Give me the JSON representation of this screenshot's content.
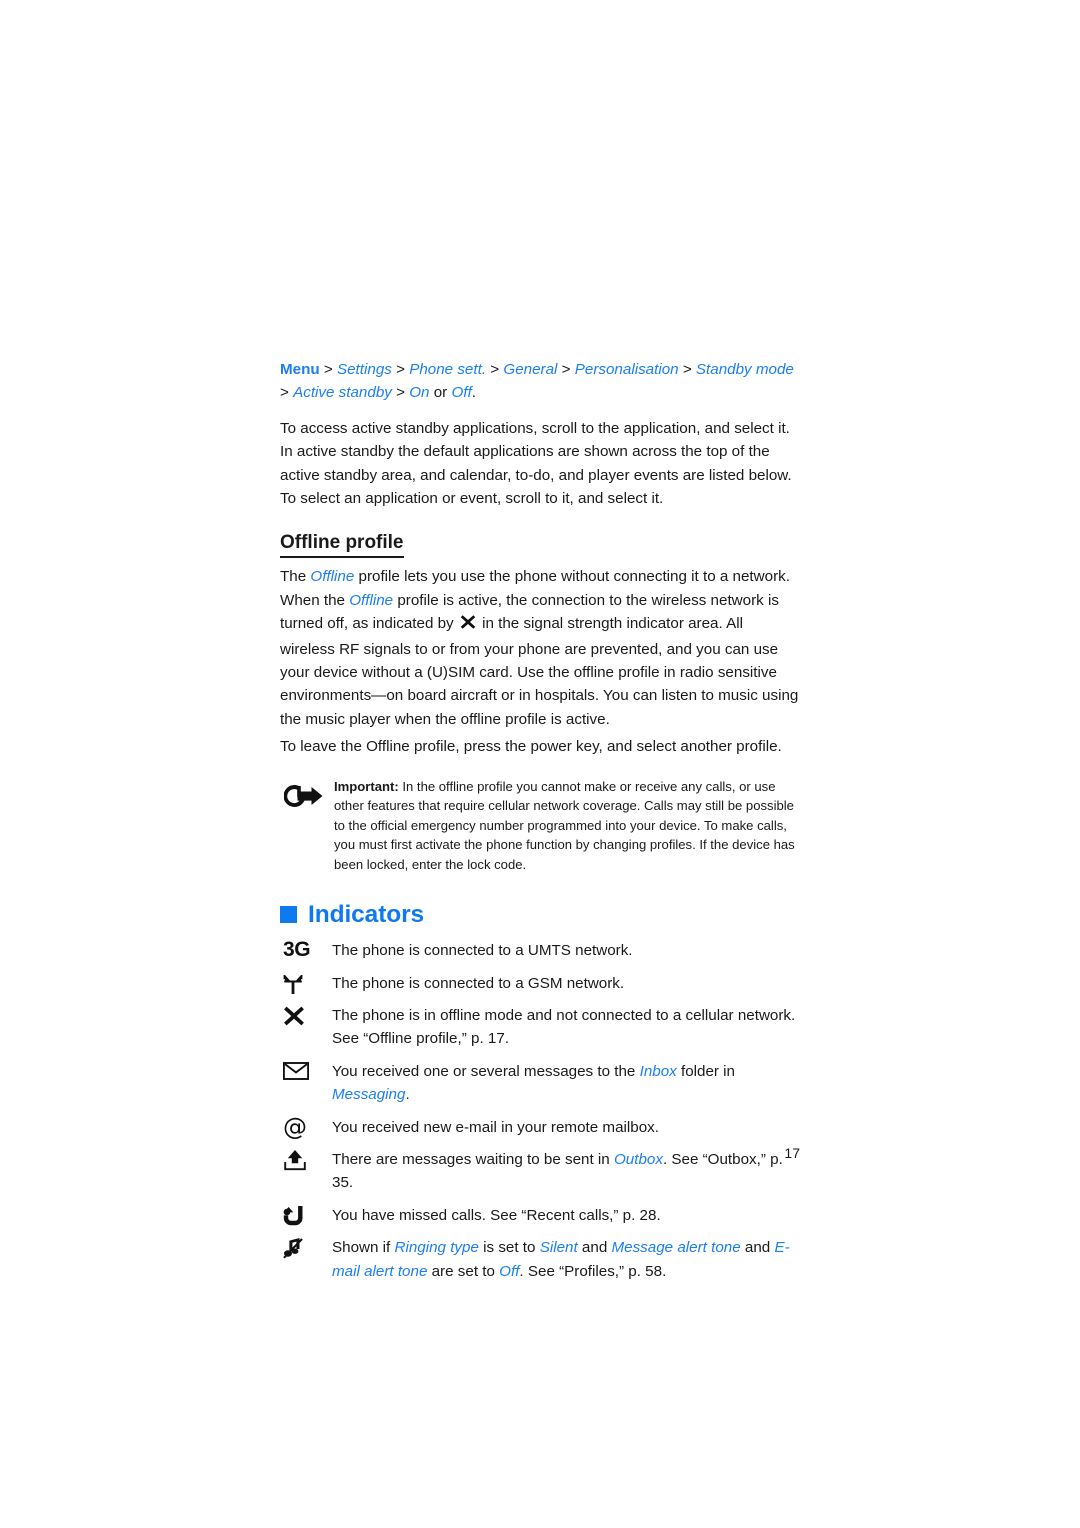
{
  "page": {
    "number": "17"
  },
  "menu_path": {
    "root": "Menu",
    "items": [
      "Settings",
      "Phone sett.",
      "General",
      "Personalisation",
      "Standby mode",
      "Active standby",
      "On",
      "Off"
    ],
    "or_word": "or",
    "separator": ">",
    "trailing_period": "."
  },
  "intro_paragraph": "To access active standby applications, scroll to the application, and select it. In active standby the default applications are shown across the top of the active standby area, and calendar, to-do, and player events are listed below. To select an application or event, scroll to it, and select it.",
  "offline": {
    "heading": "Offline profile",
    "body_part1_a": "The ",
    "body_part1_term": "Offline",
    "body_part1_b": " profile lets you use the phone without connecting it to a network. When the ",
    "body_part2_term": "Offline",
    "body_part2_b": " profile is active, the connection to the wireless network is turned off, as indicated by ",
    "body_part3": " in the signal strength indicator area. All wireless RF signals to or from your phone are prevented, and you can use your device without a (U)SIM card. Use the offline profile in radio sensitive environments—on board aircraft or in hospitals. You can listen to music using the music player when the offline profile is active.",
    "leave_paragraph": "To leave the Offline profile, press the power key, and select another profile."
  },
  "important_note": {
    "icon": "important-arrow-icon",
    "label": "Important:",
    "text": " In the offline profile you cannot make or receive any calls, or use other features that require cellular network coverage. Calls may still be possible to the official emergency number programmed into your device. To make calls, you must first activate the phone function by changing profiles. If the device has been locked, enter the lock code."
  },
  "indicators_section": {
    "title": "Indicators",
    "bullet_color": "#0f79f2",
    "rows": [
      {
        "icon": "umts-3g-icon",
        "glyph": "3G",
        "text": "The phone is connected to a UMTS network."
      },
      {
        "icon": "gsm-antenna-icon",
        "glyph": "",
        "text": "The phone is connected to a GSM network."
      },
      {
        "icon": "offline-x-icon",
        "glyph": "✖",
        "text_a": "The phone is in offline mode and not connected to a cellular network. See “Offline profile,” p. 17."
      },
      {
        "icon": "envelope-message-icon",
        "glyph": "",
        "text_a": "You received one or several messages to the ",
        "term1": "Inbox",
        "text_b": " folder in ",
        "term2": "Messaging",
        "text_c": "."
      },
      {
        "icon": "at-email-icon",
        "glyph": "@",
        "text": "You received new e-mail in your remote mailbox."
      },
      {
        "icon": "outbox-upload-icon",
        "glyph": "",
        "text_a": "There are messages waiting to be sent in ",
        "term1": "Outbox",
        "text_b": ". See “Outbox,” p. 35."
      },
      {
        "icon": "missed-call-icon",
        "glyph": "",
        "text": "You have missed calls. See “Recent calls,” p. 28."
      },
      {
        "icon": "silent-mute-note-icon",
        "glyph": "",
        "text_a": "Shown if ",
        "term1": "Ringing type",
        "text_b": " is set to ",
        "term2": "Silent",
        "text_c": " and ",
        "term3": "Message alert tone",
        "text_d": " and ",
        "term4": "E-mail alert tone",
        "text_e": " are set to ",
        "term5": "Off",
        "text_f": ". See “Profiles,” p. 58."
      }
    ]
  }
}
